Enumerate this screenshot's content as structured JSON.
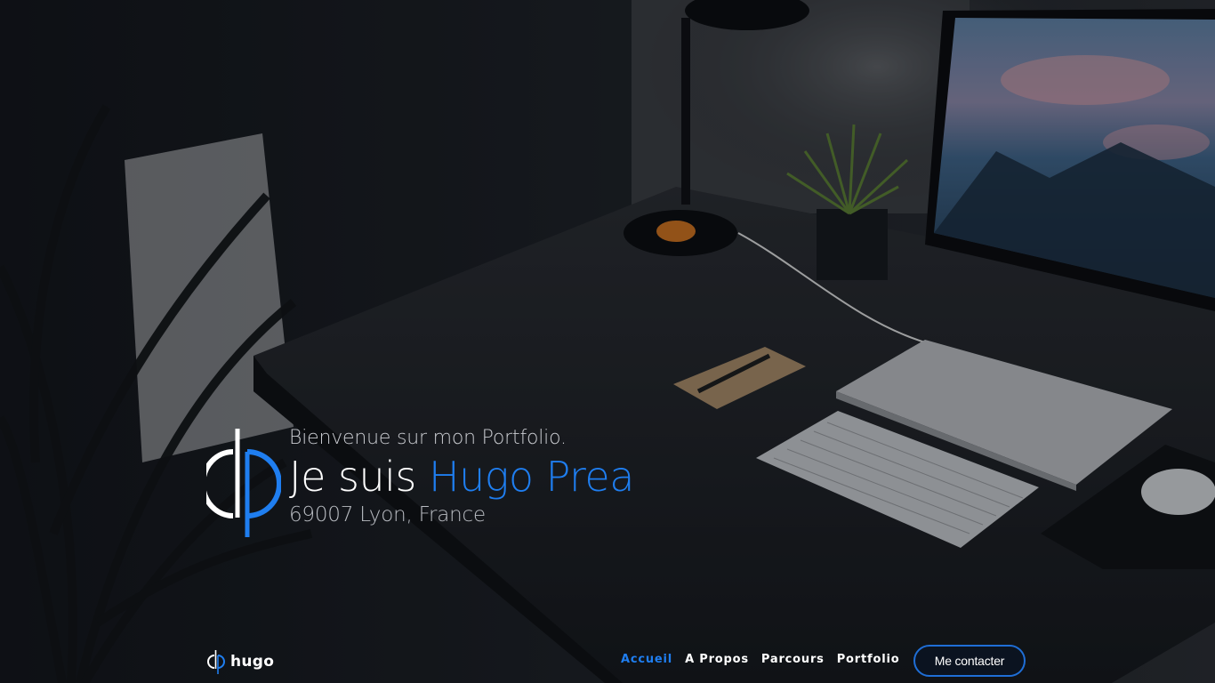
{
  "hero": {
    "welcome": "Bienvenue sur mon Portfolio.",
    "title_prefix": "Je suis ",
    "title_name": "Hugo Prea",
    "location": "69007 Lyon, France"
  },
  "brand": {
    "name": "hugo",
    "logo_icon": "hp-monogram-icon"
  },
  "nav": {
    "items": [
      {
        "label": "Accueil",
        "active": true
      },
      {
        "label": "A Propos",
        "active": false
      },
      {
        "label": "Parcours",
        "active": false
      },
      {
        "label": "Portfolio",
        "active": false
      }
    ],
    "contact_label": "Me contacter"
  },
  "colors": {
    "accent": "#1f7ef0",
    "background": "#0d0f13",
    "text": "#ffffff"
  }
}
